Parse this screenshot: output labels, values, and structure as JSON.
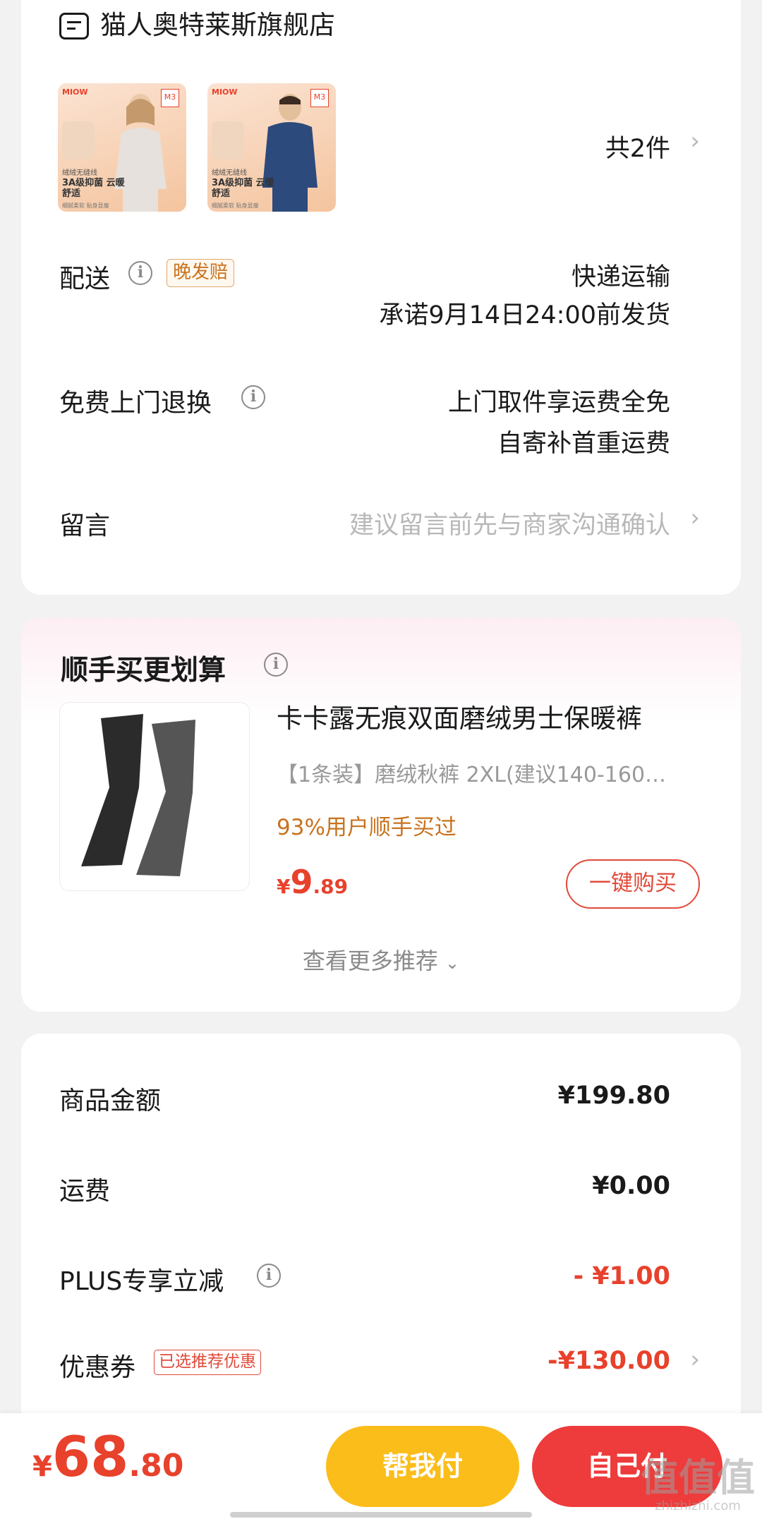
{
  "store": {
    "name": "猫人奥特莱斯旗舰店",
    "icon": "store-icon",
    "items_count": "共2件"
  },
  "products": [
    {
      "brand": "MIOW",
      "badge": "M3",
      "tag1": "绒绒无缝线",
      "tag2": "3A级抑菌 云暖舒适",
      "tag3": "细腻柔软 贴身显瘦"
    },
    {
      "brand": "MIOW",
      "badge": "M3",
      "tag1": "绒绒无缝线",
      "tag2": "3A级抑菌 云暖舒适",
      "tag3": "细腻柔软 贴身显瘦"
    }
  ],
  "delivery": {
    "label": "配送",
    "badge": "晚发赔",
    "method": "快递运输",
    "promise": "承诺9月14日24:00前发货"
  },
  "return_service": {
    "label": "免费上门退换",
    "line1": "上门取件享运费全免",
    "line2": "自寄补首重运费"
  },
  "message": {
    "label": "留言",
    "placeholder": "建议留言前先与商家沟通确认"
  },
  "addon": {
    "title": "顺手买更划算",
    "product_name": "卡卡露无痕双面磨绒男士保暖裤",
    "spec": "【1条装】磨绒秋裤   2XL(建议140-160…",
    "social_proof": "93%用户顺手买过",
    "price_symbol": "¥",
    "price_int": "9",
    "price_dec": ".89",
    "buy_label": "一键购买",
    "more_label": "查看更多推荐"
  },
  "summary": {
    "goods_label": "商品金额",
    "goods_value": "¥199.80",
    "shipping_label": "运费",
    "shipping_value": "¥0.00",
    "plus_label": "PLUS专享立减",
    "plus_value": "- ¥1.00",
    "coupon_label": "优惠券",
    "coupon_badge": "已选推荐优惠",
    "coupon_value": "-¥130.00"
  },
  "footer": {
    "price_symbol": "¥",
    "price_int": "68",
    "price_dec": ".80",
    "help_pay_label": "帮我付",
    "self_pay_label": "自己付"
  },
  "watermark": {
    "text": "值值值",
    "sub": "zhizhizhi.com"
  },
  "colors": {
    "accent_red": "#e8412c",
    "help_pay_yellow": "#fbbd1a",
    "self_pay_red": "#ee3b3b",
    "badge_orange": "#c8731f"
  }
}
